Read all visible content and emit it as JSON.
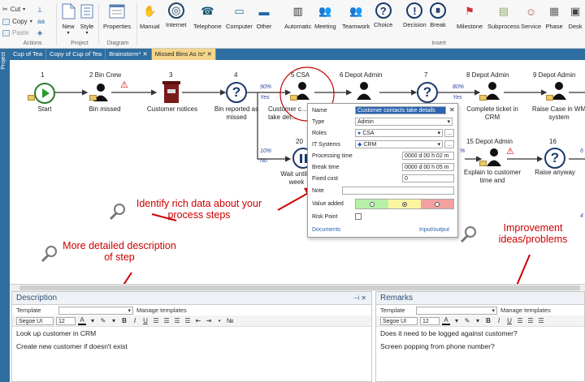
{
  "ribbon": {
    "clipboard": {
      "cut": "Cut",
      "copy": "Copy",
      "paste": "Paste",
      "aa": "aa"
    },
    "groups": {
      "actions": "Actions",
      "project": "Project",
      "diagram": "Diagram",
      "insert": "Insert"
    },
    "buttons": {
      "new": "New",
      "style": "Style",
      "properties": "Properties"
    },
    "insert_items": [
      "Manual",
      "Internet",
      "Telephone",
      "Computer",
      "Other",
      "Automatic",
      "Meeting",
      "Teamwork",
      "Choice",
      "Decision",
      "Break",
      "Milestone",
      "Subprocess",
      "Service",
      "Phase",
      "Desk"
    ]
  },
  "tabs": [
    {
      "label": "Cup of Tea"
    },
    {
      "label": "Copy of Cup of Tea"
    },
    {
      "label": "Brainstorm*"
    },
    {
      "label": "Missed Bins As Is*"
    }
  ],
  "sidebar": {
    "label": "Project"
  },
  "diagram": {
    "steps": [
      {
        "num": "1",
        "label": "Start"
      },
      {
        "num": "2 Bin Crew",
        "label": "Bin missed"
      },
      {
        "num": "3",
        "label": "Customer notices"
      },
      {
        "num": "4",
        "label": "Bin reported as missed"
      },
      {
        "num": "5 CSA",
        "label": "Customer c... take det..."
      },
      {
        "num": "6 Depot Admin",
        "label": ""
      },
      {
        "num": "7",
        "label": ""
      },
      {
        "num": "8 Depot Admin",
        "label": "Complete ticket in CRM"
      },
      {
        "num": "9 Depot Admin",
        "label": "Raise Case in WM system"
      },
      {
        "num": "20",
        "label": "Wait until... week"
      },
      {
        "num": "15 Depot Admin",
        "label": "Explain to customer time and"
      },
      {
        "num": "16",
        "label": "Raise anyway"
      }
    ],
    "pcts": [
      {
        "text": "90%"
      },
      {
        "text": "Yes"
      },
      {
        "text": "10%"
      },
      {
        "text": "No"
      },
      {
        "text": "80%"
      },
      {
        "text": "Yes"
      },
      {
        "text": "%"
      },
      {
        "text": "6"
      },
      {
        "text": "4"
      }
    ]
  },
  "popup": {
    "name_label": "Name",
    "name_value": "Customer contacts take details",
    "type_label": "Type",
    "type_value": "Admin",
    "roles_label": "Roles",
    "roles_value": "CSA",
    "it_label": "IT Systems",
    "it_value": "CRM",
    "proc_label": "Processing time",
    "proc_value": "0000 d 00 h 02 m",
    "break_label": "Break time",
    "break_value": "0000 d 00 h 05 m",
    "cost_label": "Fixed cost",
    "cost_value": "0",
    "note_label": "Note",
    "value_label": "Value added",
    "risk_label": "Risk Point",
    "documents": "Documents",
    "io": "Input/output",
    "colors": {
      "green": "#b6f0a8",
      "yellow": "#fbf5a0",
      "red": "#f2a0a0"
    }
  },
  "annotations": {
    "rich": "Identify rich data about your process steps",
    "desc": "More detailed description of step",
    "improve": "Improvement ideas/problems"
  },
  "description": {
    "title": "Description",
    "template_label": "Template",
    "manage": "Manage templates",
    "font": "Segoe UI",
    "size": "12",
    "lines": [
      "Look up customer in CRM",
      "Create new customer if doesn't exist"
    ]
  },
  "remarks": {
    "title": "Remarks",
    "template_label": "Template",
    "manage": "Manage templates",
    "font": "Segoe UI",
    "size": "12",
    "lines": [
      "Does it need to be logged against customer?",
      "Screen popping from phone number?"
    ]
  },
  "colors": {
    "accent": "#2f6ea0",
    "active_tab": "#f4d58a",
    "annotation": "#cc0000"
  }
}
